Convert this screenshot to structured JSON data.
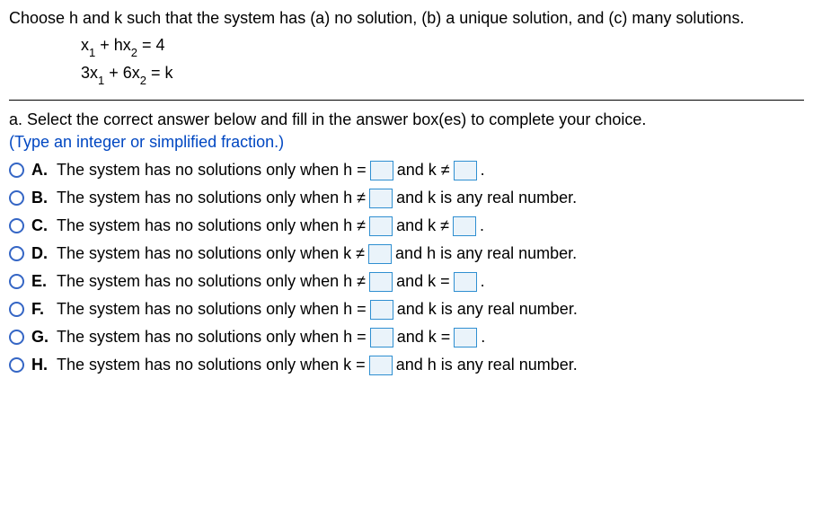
{
  "question": "Choose h and k such that the system has (a) no solution, (b) a unique solution, and (c) many solutions.",
  "equations": {
    "line1_lhs": "x",
    "line1_sub1": "1",
    "line1_mid": " + hx",
    "line1_sub2": "2",
    "line1_rhs": "  =  4",
    "line2_lhs": "3x",
    "line2_sub1": "1",
    "line2_mid": " + 6x",
    "line2_sub2": "2",
    "line2_rhs": "  =  k"
  },
  "part_a_prompt": "a. Select the correct answer below and fill in the answer box(es) to complete your choice.",
  "hint": "(Type an integer or simplified fraction.)",
  "options": [
    {
      "letter": "A.",
      "pre": "The system has no solutions only when h =",
      "mid": "and k ≠",
      "post": "."
    },
    {
      "letter": "B.",
      "pre": "The system has no solutions only when h ≠",
      "mid": "and k is any real number.",
      "post": ""
    },
    {
      "letter": "C.",
      "pre": "The system has no solutions only when h ≠",
      "mid": "and k ≠",
      "post": "."
    },
    {
      "letter": "D.",
      "pre": "The system has no solutions only when k ≠",
      "mid": "and h is any real number.",
      "post": ""
    },
    {
      "letter": "E.",
      "pre": "The system has no solutions only when h ≠",
      "mid": "and k =",
      "post": "."
    },
    {
      "letter": "F.",
      "pre": "The system has no solutions only when h =",
      "mid": "and k is any real number.",
      "post": ""
    },
    {
      "letter": "G.",
      "pre": "The system has no solutions only when h =",
      "mid": "and k =",
      "post": "."
    },
    {
      "letter": "H.",
      "pre": "The system has no solutions only when k =",
      "mid": "and h is any real number.",
      "post": ""
    }
  ]
}
